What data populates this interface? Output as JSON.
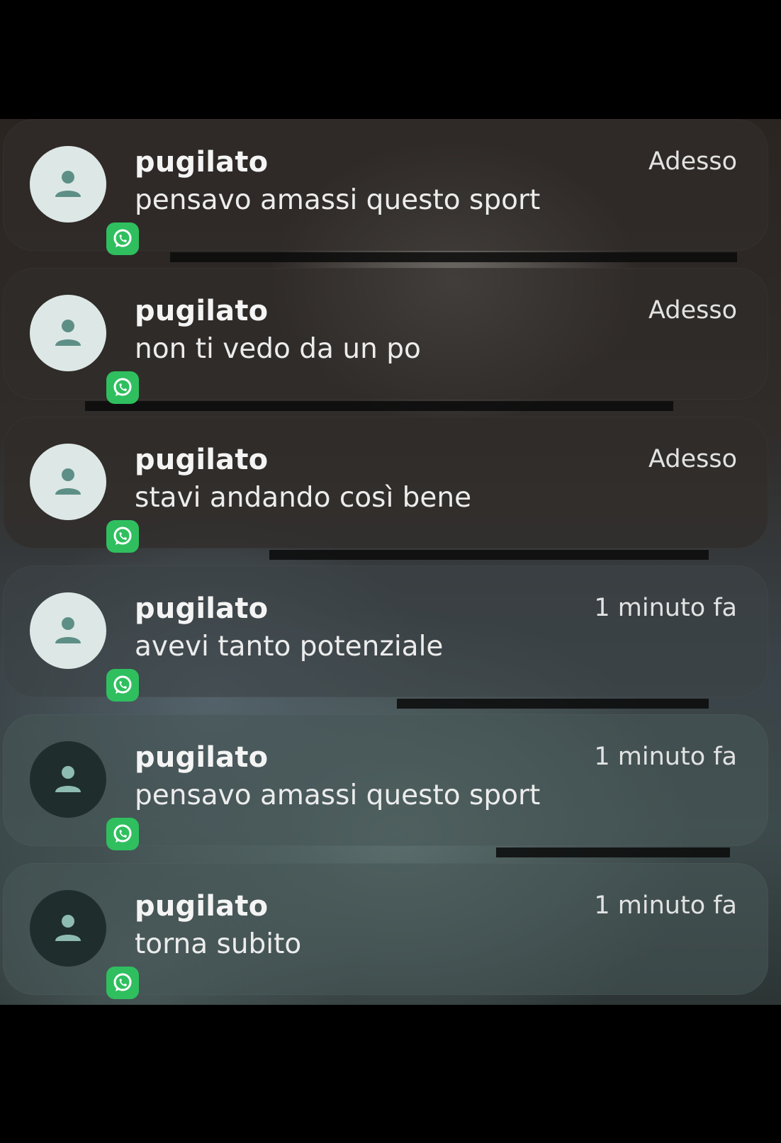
{
  "notifications": [
    {
      "app_icon": "whatsapp-icon",
      "avatar_icon": "person-icon",
      "avatar_style": "light",
      "sender": "pugilato",
      "message": "pensavo amassi questo sport",
      "time": "Adesso"
    },
    {
      "app_icon": "whatsapp-icon",
      "avatar_icon": "person-icon",
      "avatar_style": "light",
      "sender": "pugilato",
      "message": "non ti vedo da un po",
      "time": "Adesso"
    },
    {
      "app_icon": "whatsapp-icon",
      "avatar_icon": "person-icon",
      "avatar_style": "light",
      "sender": "pugilato",
      "message": "stavi andando così bene",
      "time": "Adesso"
    },
    {
      "app_icon": "whatsapp-icon",
      "avatar_icon": "person-icon",
      "avatar_style": "light",
      "sender": "pugilato",
      "message": "avevi tanto potenziale",
      "time": "1 minuto fa"
    },
    {
      "app_icon": "whatsapp-icon",
      "avatar_icon": "person-icon",
      "avatar_style": "dark",
      "sender": "pugilato",
      "message": "pensavo amassi questo sport",
      "time": "1 minuto fa"
    },
    {
      "app_icon": "whatsapp-icon",
      "avatar_icon": "person-icon",
      "avatar_style": "dark",
      "sender": "pugilato",
      "message": "torna subito",
      "time": "1 minuto fa"
    }
  ],
  "colors": {
    "whatsapp_green": "#2fbf5f",
    "avatar_light": "#dde8e6",
    "avatar_dark": "#1f2e2c",
    "person_icon": "#5e8f86"
  }
}
